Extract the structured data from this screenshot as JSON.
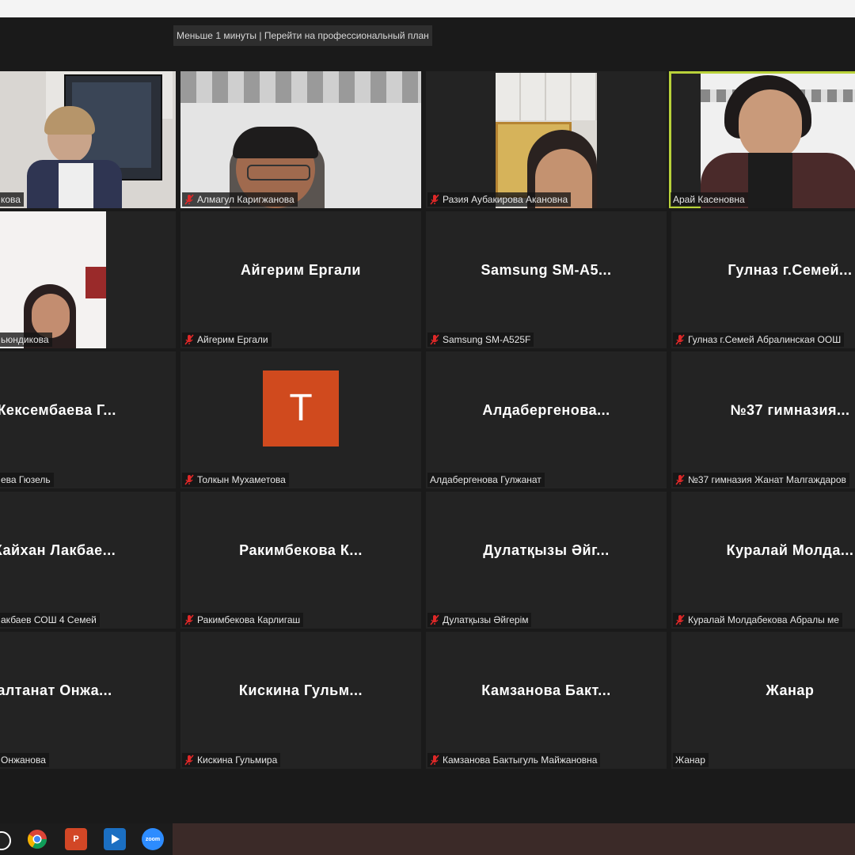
{
  "banner": {
    "text": "Меньше 1 минуты | Перейти на профессиональный план"
  },
  "tiles": [
    {
      "label": "кова"
    },
    {
      "label": "Алмагул Каригжанова"
    },
    {
      "label": "Разия Аубакирова Акановна"
    },
    {
      "label": "Арай Касеновна"
    },
    {
      "label": "ьюндикова"
    },
    {
      "center": "Айгерим Ергали",
      "label": "Айгерим Ергали"
    },
    {
      "center": "Samsung  SM-A5...",
      "label": "Samsung SM-A525F"
    },
    {
      "center": "Гулназ  г.Семей...",
      "label": "Гулназ г.Семей Абралинская ООШ"
    },
    {
      "center": "Жексембаева  Г...",
      "label": "ева Гюзель"
    },
    {
      "avatar_letter": "T",
      "label": "Толкын Мухаметова"
    },
    {
      "center": "Алдабергенова...",
      "label": "Алдабергенова Гулжанат"
    },
    {
      "center": "№37  гимназия...",
      "label": "№37 гимназия Жанат Малгаждаров"
    },
    {
      "center": "Кайхан  Лакбае...",
      "label": "акбаев СОШ 4 Семей"
    },
    {
      "center": "Ракимбекова  К...",
      "label": "Ракимбекова Карлигаш"
    },
    {
      "center": "Дулатқызы  Әйг...",
      "label": "Дулатқызы Әйгерім"
    },
    {
      "center": "Куралай  Молда...",
      "label": "Куралай Молдабекова Абралы ме"
    },
    {
      "center": "алтанат  Онжа...",
      "label": "Онжанова"
    },
    {
      "center": "Кискина  Гульм...",
      "label": "Кискина Гульмира"
    },
    {
      "center": "Камзанова  Бакт...",
      "label": "Камзанова Бактыгуль Майжановна"
    },
    {
      "center": "Жанар",
      "label": "Жанар"
    }
  ],
  "taskbar": {
    "icons": [
      "media-icon",
      "chrome-icon",
      "powerpoint-icon",
      "windows-media-icon",
      "zoom-icon"
    ],
    "powerpoint_letter": "P",
    "zoom_text": "zoom"
  },
  "colors": {
    "active_border": "#b9d23a",
    "avatar_bg": "#d04a1e",
    "mic_muted": "#e02828"
  }
}
